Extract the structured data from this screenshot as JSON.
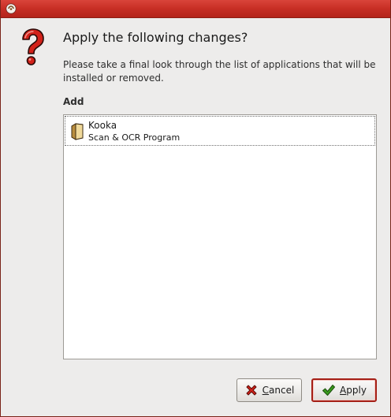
{
  "window": {
    "title": ""
  },
  "icons": {
    "window_menu": "app-menu-icon",
    "dialog": "question-icon",
    "app": "package-icon",
    "cancel": "red-x-icon",
    "apply": "green-check-icon"
  },
  "dialog": {
    "heading": "Apply the following changes?",
    "description": "Please take a final look through the list of applications that will be installed or removed.",
    "section_label": "Add"
  },
  "list": {
    "items": [
      {
        "name": "Kooka",
        "description": "Scan & OCR Program"
      }
    ]
  },
  "buttons": {
    "cancel": {
      "mnemonic": "C",
      "rest": "ancel"
    },
    "apply": {
      "mnemonic": "A",
      "rest": "pply"
    }
  },
  "colors": {
    "titlebar": "#c93026",
    "dialog_background": "#edeceb",
    "default_button_border": "#a51f16",
    "question_mark": "#d3221a",
    "check": "#3a9a1e"
  }
}
